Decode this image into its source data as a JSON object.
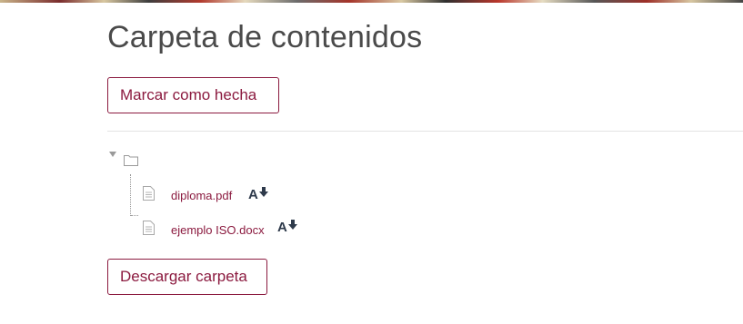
{
  "page": {
    "title": "Carpeta de contenidos"
  },
  "actions": {
    "mark_done_label": "Marcar como hecha",
    "download_folder_label": "Descargar carpeta"
  },
  "folder_tree": {
    "expanded": true,
    "folder_icon": "folder-icon",
    "files": [
      {
        "name": "diploma.pdf",
        "icon": "file-icon",
        "alt_format_icon": "accessibility-download-icon"
      },
      {
        "name": "ejemplo ISO.docx",
        "icon": "file-icon",
        "alt_format_icon": "accessibility-download-icon"
      }
    ]
  },
  "colors": {
    "accent": "#8b1a3f",
    "title": "#4a4a4a",
    "divider": "#e3e3e3"
  }
}
